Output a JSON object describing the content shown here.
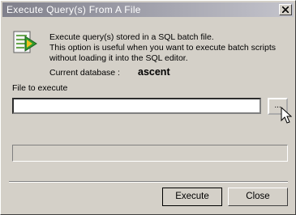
{
  "window": {
    "title": "Execute Query(s) From A File",
    "close_icon": "close-icon"
  },
  "info": {
    "icon": "sql-script-file-icon",
    "line1": "Execute query(s) stored in a SQL batch file.",
    "line2": "This option is useful when you want to execute batch scripts",
    "line3": "without loading it into the SQL editor.",
    "db_label": "Current database :",
    "db_value": "ascent"
  },
  "file": {
    "label": "File to execute",
    "value": "",
    "browse_label": "..."
  },
  "progress": {
    "value": 0
  },
  "buttons": {
    "execute_label": "Execute",
    "close_label": "Close"
  }
}
